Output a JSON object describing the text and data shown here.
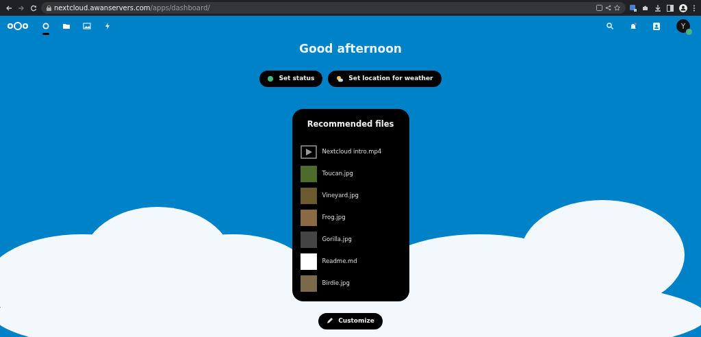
{
  "browser": {
    "url_host": "nextcloud.awanservers.com",
    "url_path": "/apps/dashboard/"
  },
  "header": {
    "apps": [
      {
        "kind": "dashboard",
        "selected": true
      },
      {
        "kind": "files",
        "selected": false
      },
      {
        "kind": "photos",
        "selected": false
      },
      {
        "kind": "activity",
        "selected": false
      }
    ],
    "avatar_letter": "Y"
  },
  "greeting": "Good afternoon",
  "actions": [
    {
      "kind": "status",
      "label": "Set status"
    },
    {
      "kind": "weather",
      "label": "Set location for weather"
    }
  ],
  "widget": {
    "title": "Recommended files",
    "files": [
      {
        "kind": "video",
        "name": "Nextcloud intro.mp4"
      },
      {
        "kind": "image",
        "name": "Toucan.jpg"
      },
      {
        "kind": "image",
        "name": "Vineyard.jpg"
      },
      {
        "kind": "image",
        "name": "Frog.jpg"
      },
      {
        "kind": "image",
        "name": "Gorilla.jpg"
      },
      {
        "kind": "document",
        "name": "Readme.md"
      },
      {
        "kind": "image",
        "name": "Birdie.jpg"
      }
    ]
  },
  "customize": "Customize"
}
